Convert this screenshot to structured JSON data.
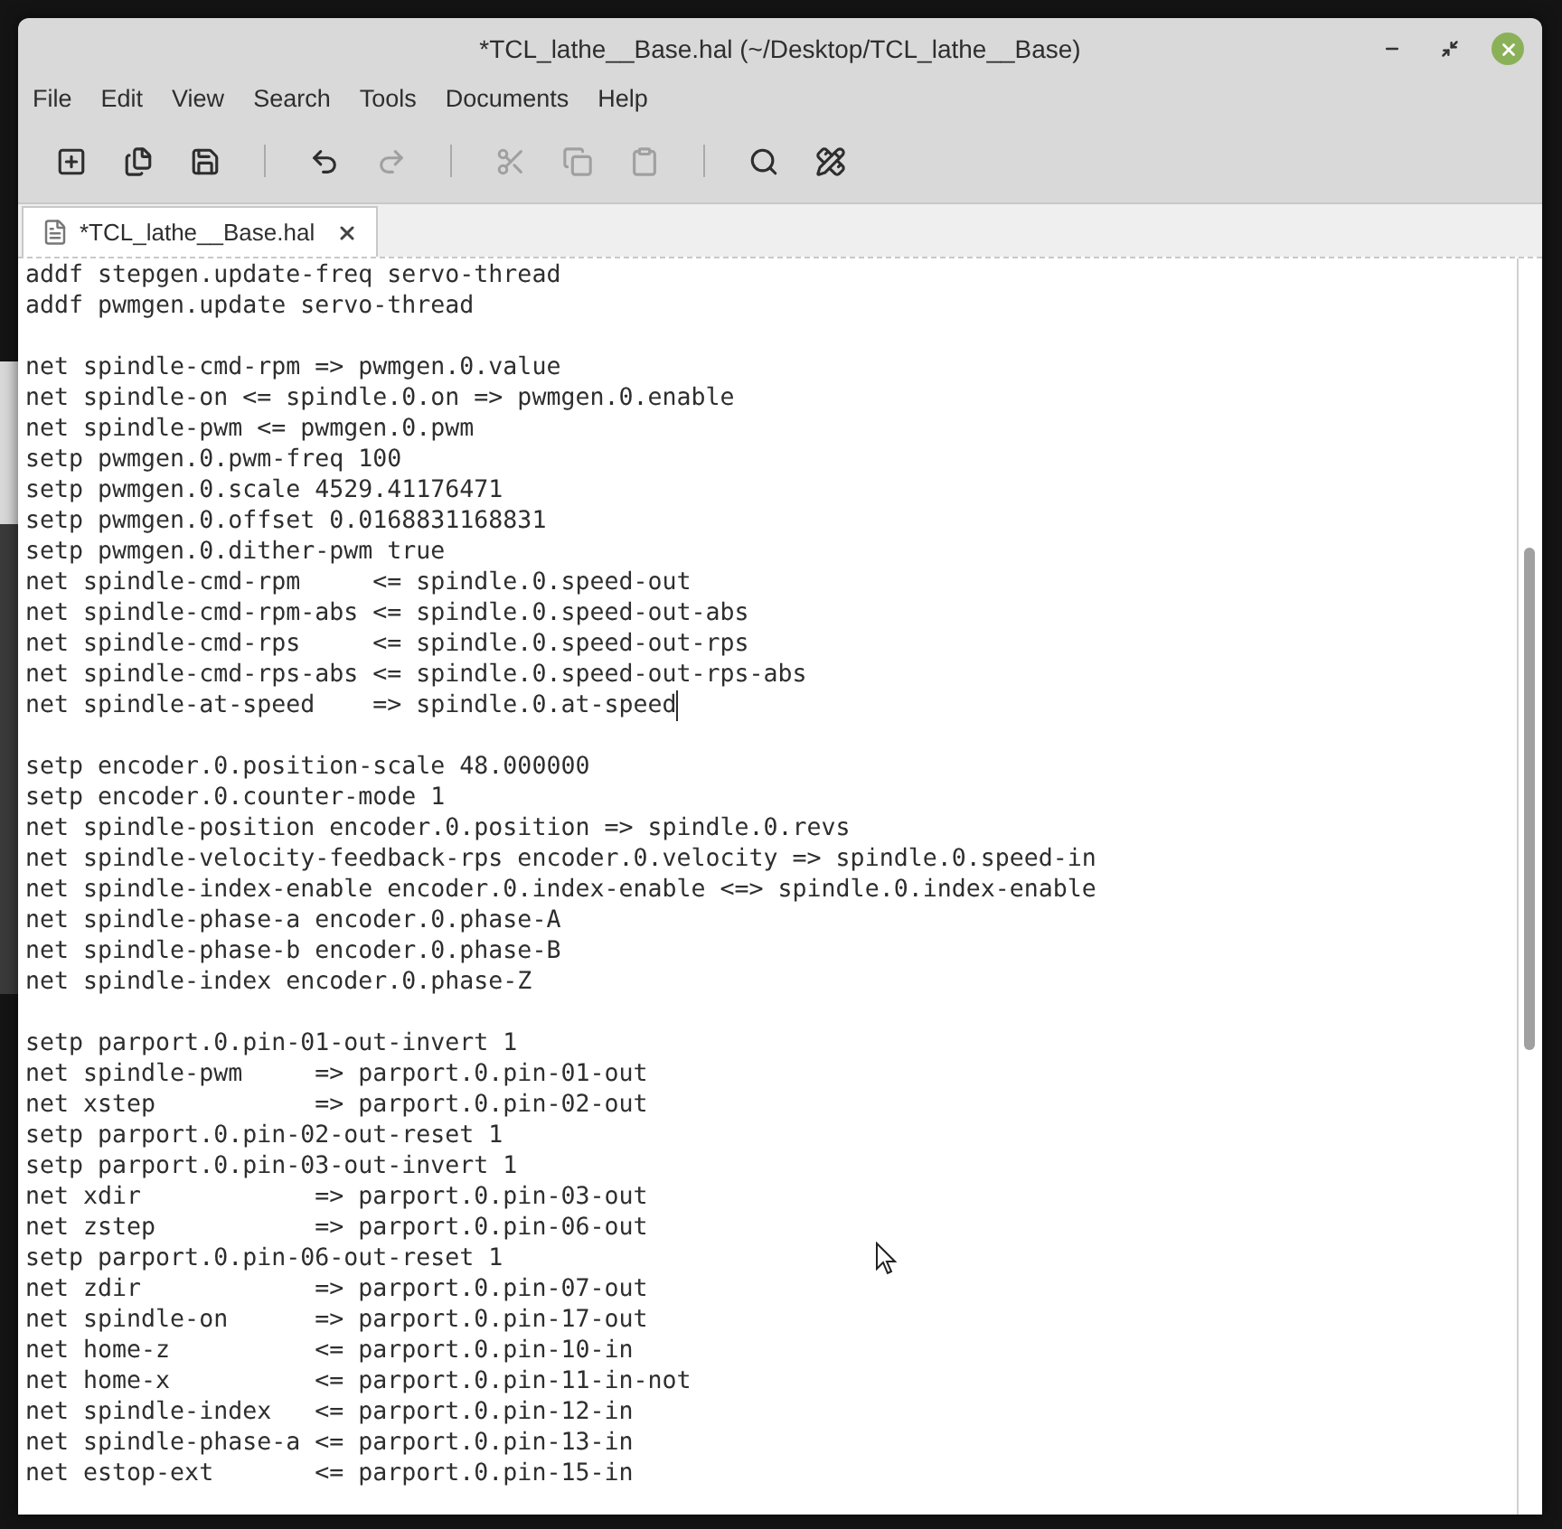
{
  "window": {
    "title": "*TCL_lathe__Base.hal (~/Desktop/TCL_lathe__Base)"
  },
  "menu": [
    "File",
    "Edit",
    "View",
    "Search",
    "Tools",
    "Documents",
    "Help"
  ],
  "toolbar": [
    {
      "kind": "new",
      "disabled": false
    },
    {
      "kind": "open",
      "disabled": false
    },
    {
      "kind": "save",
      "disabled": false
    },
    {
      "kind": "separator"
    },
    {
      "kind": "undo",
      "disabled": false
    },
    {
      "kind": "redo",
      "disabled": true
    },
    {
      "kind": "separator"
    },
    {
      "kind": "cut",
      "disabled": true
    },
    {
      "kind": "copy",
      "disabled": true
    },
    {
      "kind": "paste",
      "disabled": true
    },
    {
      "kind": "separator"
    },
    {
      "kind": "find",
      "disabled": false
    },
    {
      "kind": "tools",
      "disabled": false
    }
  ],
  "tabs": [
    {
      "label": "*TCL_lathe__Base.hal",
      "selected": true
    }
  ],
  "editor": {
    "blocks": [
      [
        {
          "text": "addf stepgen.update-freq servo-thread",
          "caret": false
        },
        {
          "text": "addf pwmgen.update servo-thread",
          "caret": false
        }
      ],
      [
        {
          "text": "net spindle-cmd-rpm => pwmgen.0.value",
          "caret": false
        },
        {
          "text": "net spindle-on <= spindle.0.on => pwmgen.0.enable",
          "caret": false
        },
        {
          "text": "net spindle-pwm <= pwmgen.0.pwm",
          "caret": false
        },
        {
          "text": "setp pwmgen.0.pwm-freq 100",
          "caret": false
        },
        {
          "text": "setp pwmgen.0.scale 4529.41176471",
          "caret": false
        },
        {
          "text": "setp pwmgen.0.offset 0.0168831168831",
          "caret": false
        },
        {
          "text": "setp pwmgen.0.dither-pwm true",
          "caret": false
        },
        {
          "text": "net spindle-cmd-rpm     <= spindle.0.speed-out",
          "caret": false
        },
        {
          "text": "net spindle-cmd-rpm-abs <= spindle.0.speed-out-abs",
          "caret": false
        },
        {
          "text": "net spindle-cmd-rps     <= spindle.0.speed-out-rps",
          "caret": false
        },
        {
          "text": "net spindle-cmd-rps-abs <= spindle.0.speed-out-rps-abs",
          "caret": false
        },
        {
          "text": "net spindle-at-speed    => spindle.0.at-speed",
          "caret": true
        }
      ],
      [
        {
          "text": "setp encoder.0.position-scale 48.000000",
          "caret": false
        },
        {
          "text": "setp encoder.0.counter-mode 1",
          "caret": false
        },
        {
          "text": "net spindle-position encoder.0.position => spindle.0.revs",
          "caret": false
        },
        {
          "text": "net spindle-velocity-feedback-rps encoder.0.velocity => spindle.0.speed-in",
          "caret": false
        },
        {
          "text": "net spindle-index-enable encoder.0.index-enable <=> spindle.0.index-enable",
          "caret": false
        },
        {
          "text": "net spindle-phase-a encoder.0.phase-A",
          "caret": false
        },
        {
          "text": "net spindle-phase-b encoder.0.phase-B",
          "caret": false
        },
        {
          "text": "net spindle-index encoder.0.phase-Z",
          "caret": false
        }
      ],
      [
        {
          "text": "setp parport.0.pin-01-out-invert 1",
          "caret": false
        },
        {
          "text": "net spindle-pwm     => parport.0.pin-01-out",
          "caret": false
        },
        {
          "text": "net xstep           => parport.0.pin-02-out",
          "caret": false
        },
        {
          "text": "setp parport.0.pin-02-out-reset 1",
          "caret": false
        },
        {
          "text": "setp parport.0.pin-03-out-invert 1",
          "caret": false
        },
        {
          "text": "net xdir            => parport.0.pin-03-out",
          "caret": false
        },
        {
          "text": "net zstep           => parport.0.pin-06-out",
          "caret": false
        },
        {
          "text": "setp parport.0.pin-06-out-reset 1",
          "caret": false
        },
        {
          "text": "net zdir            => parport.0.pin-07-out",
          "caret": false
        },
        {
          "text": "net spindle-on      => parport.0.pin-17-out",
          "caret": false
        },
        {
          "text": "net home-z          <= parport.0.pin-10-in",
          "caret": false
        },
        {
          "text": "net home-x          <= parport.0.pin-11-in-not",
          "caret": false
        },
        {
          "text": "net spindle-index   <= parport.0.pin-12-in",
          "caret": false
        },
        {
          "text": "net spindle-phase-a <= parport.0.pin-13-in",
          "caret": false
        },
        {
          "text": "net estop-ext       <= parport.0.pin-15-in",
          "caret": false
        }
      ]
    ]
  }
}
